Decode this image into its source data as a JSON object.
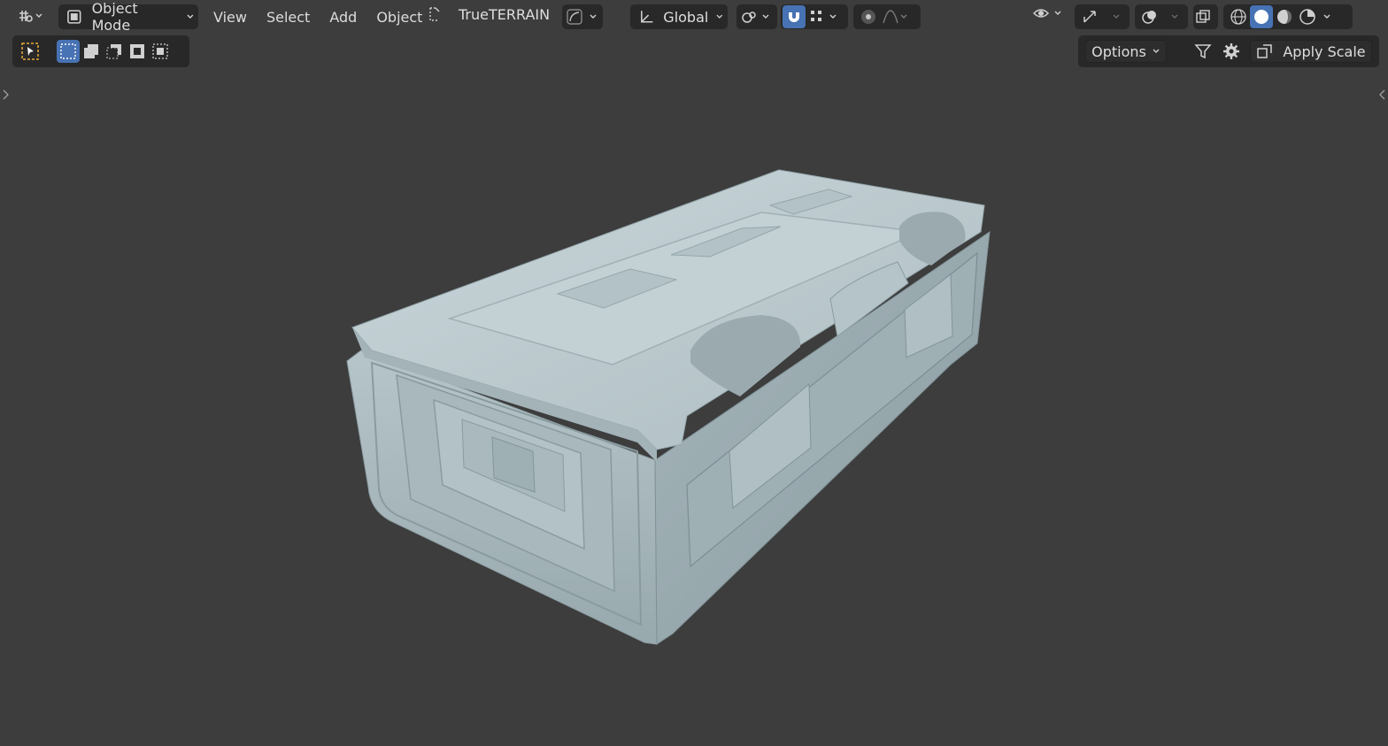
{
  "header": {
    "mode_label": "Object Mode",
    "menus": [
      "View",
      "Select",
      "Add",
      "Object"
    ],
    "addon_label": "TrueTERRAIN",
    "transform_orientation": "Global"
  },
  "tool_header": {
    "options_label": "Options",
    "apply_scale_label": "Apply Scale"
  },
  "icons": {
    "editor_type": "editor-type-icon",
    "mode": "object-mode-icon",
    "addon": "trueterrain-icon",
    "curve": "curve-icon",
    "orientation": "transform-orientation-icon",
    "pivot": "pivot-point-icon",
    "snap": "snap-magnet-icon",
    "snap_target": "snap-grid-icon",
    "proportional": "proportional-edit-icon",
    "falloff": "falloff-icon",
    "visibility": "eye-icon",
    "gizmo": "gizmo-icon",
    "overlay": "overlay-icon",
    "xray": "xray-icon",
    "shading_wire": "wireframe-shading-icon",
    "shading_solid": "solid-shading-icon",
    "shading_material": "material-preview-icon",
    "shading_render": "rendered-shading-icon",
    "filter": "filter-icon",
    "settings": "gear-icon"
  },
  "colors": {
    "viewport_bg": "#3d3d3d",
    "active_blue": "#4772b3",
    "model": "#b9c8cc"
  }
}
